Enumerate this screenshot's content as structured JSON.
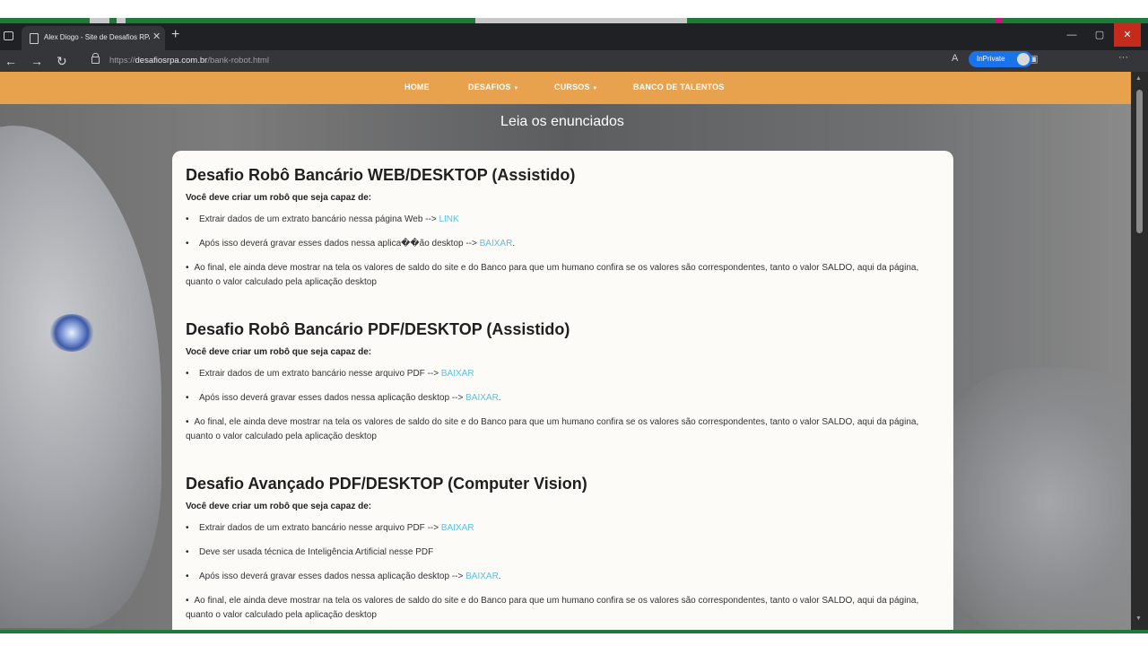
{
  "browser": {
    "tab_title": "Alex Diogo - Site de Desafios RPA",
    "tab_close": "✕",
    "new_tab": "+",
    "url_scheme": "https://",
    "url_host": "desafiosrpa.com.br",
    "url_path": "/bank-robot.html",
    "inprivate_label": "InPrivate",
    "window_minimize": "—",
    "window_maximize": "▢",
    "window_close": "✕",
    "more": "···",
    "icons": [
      "back-icon",
      "forward-icon",
      "refresh-icon",
      "lock-icon",
      "read-aloud-icon",
      "favorite-icon",
      "favorites-bar-icon",
      "collections-icon",
      "menu-icon"
    ]
  },
  "nav": {
    "items": [
      {
        "label": "HOME"
      },
      {
        "label": "DESAFIOS",
        "caret": "▼"
      },
      {
        "label": "CURSOS",
        "caret": "▼"
      },
      {
        "label": "BANCO DE TALENTOS"
      }
    ]
  },
  "page": {
    "heading": "Leia os enunciados"
  },
  "sections": [
    {
      "title": "Desafio Robô Bancário WEB/DESKTOP (Assistido)",
      "subtitle": "Você deve criar um robô que seja capaz de:",
      "items": [
        {
          "text": "Extrair dados de um extrato bancário nessa página Web --> ",
          "link": "LINK"
        },
        {
          "text": "Após isso deverá gravar esses dados nessa aplica��ão desktop --> ",
          "link": "BAIXAR",
          "after": "."
        },
        {
          "text": "Ao final, ele ainda deve mostrar na tela os valores de saldo do site e do Banco para que um humano confira se os valores são correspondentes, tanto o valor SALDO, aqui da página, quanto o valor calculado pela aplicação desktop"
        }
      ]
    },
    {
      "title": "Desafio Robô Bancário PDF/DESKTOP (Assistido)",
      "subtitle": "Você deve criar um robô que seja capaz de:",
      "items": [
        {
          "text": "Extrair dados de um extrato bancário nesse arquivo PDF --> ",
          "link": "BAIXAR"
        },
        {
          "text": "Após isso deverá gravar esses dados nessa aplicação desktop --> ",
          "link": "BAIXAR",
          "after": "."
        },
        {
          "text": "Ao final, ele ainda deve mostrar na tela os valores de saldo do site e do Banco para que um humano confira se os valores são correspondentes, tanto o valor SALDO, aqui da página, quanto o valor calculado pela aplicação desktop"
        }
      ]
    },
    {
      "title": "Desafio Avançado PDF/DESKTOP (Computer Vision)",
      "subtitle": "Você deve criar um robô que seja capaz de:",
      "items": [
        {
          "text": "Extrair dados de um extrato bancário nesse arquivo PDF --> ",
          "link": "BAIXAR"
        },
        {
          "text": "Deve ser usada técnica de Inteligência Artificial nesse PDF"
        },
        {
          "text": "Após isso deverá gravar esses dados nessa aplicação desktop --> ",
          "link": "BAIXAR",
          "after": "."
        },
        {
          "text": "Ao final, ele ainda deve mostrar na tela os valores de saldo do site e do Banco para que um humano confira se os valores são correspondentes, tanto o valor SALDO, aqui da página, quanto o valor calculado pela aplicação desktop"
        }
      ]
    }
  ],
  "colors": {
    "navbar": "#e8a24d",
    "link": "#5bc0de",
    "inprivate": "#1a73e8",
    "close_button": "#c42b1c"
  }
}
